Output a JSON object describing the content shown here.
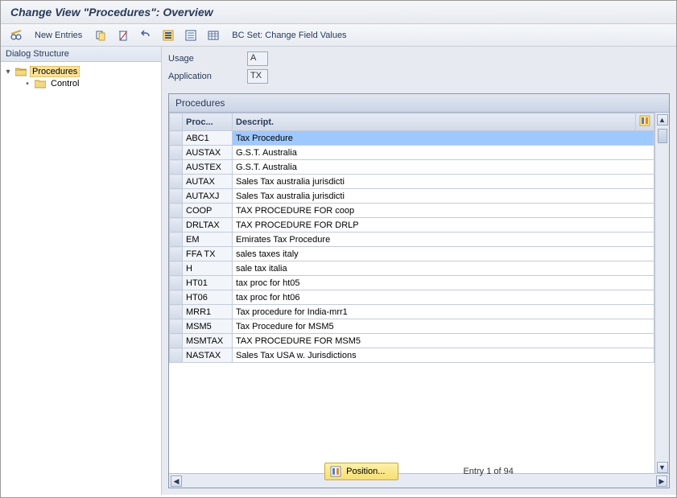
{
  "title": "Change View \"Procedures\": Overview",
  "toolbar": {
    "new_entries_label": "New Entries",
    "bcset_label": "BC Set: Change Field Values"
  },
  "sidebar": {
    "header": "Dialog Structure",
    "items": [
      {
        "label": "Procedures",
        "expanded": true,
        "selected": true,
        "folder": "open"
      },
      {
        "label": "Control",
        "expanded": false,
        "selected": false,
        "folder": "closed"
      }
    ]
  },
  "form": {
    "usage_label": "Usage",
    "usage_value": "A",
    "application_label": "Application",
    "application_value": "TX"
  },
  "table": {
    "title": "Procedures",
    "col_proc": "Proc...",
    "col_desc": "Descript.",
    "rows": [
      {
        "proc": "ABC1",
        "desc": "Tax Procedure",
        "selected": true
      },
      {
        "proc": "AUSTAX",
        "desc": "G.S.T.  Australia"
      },
      {
        "proc": "AUSTEX",
        "desc": "G.S.T.  Australia"
      },
      {
        "proc": "AUTAX",
        "desc": "Sales Tax australia jurisdicti"
      },
      {
        "proc": "AUTAXJ",
        "desc": "Sales Tax australia jurisdicti"
      },
      {
        "proc": "COOP",
        "desc": "TAX PROCEDURE FOR coop"
      },
      {
        "proc": "DRLTAX",
        "desc": "TAX PROCEDURE FOR DRLP"
      },
      {
        "proc": "EM",
        "desc": "Emirates Tax Procedure"
      },
      {
        "proc": "FFA TX",
        "desc": "sales taxes italy"
      },
      {
        "proc": "H",
        "desc": "sale tax italia"
      },
      {
        "proc": "HT01",
        "desc": "tax proc for ht05"
      },
      {
        "proc": "HT06",
        "desc": "tax proc for ht06"
      },
      {
        "proc": "MRR1",
        "desc": "Tax procedure for India-mrr1"
      },
      {
        "proc": "MSM5",
        "desc": "Tax Procedure for MSM5"
      },
      {
        "proc": "MSMTAX",
        "desc": "TAX PROCEDURE FOR MSM5"
      },
      {
        "proc": "NASTAX",
        "desc": "Sales Tax USA w. Jurisdictions"
      }
    ]
  },
  "footer": {
    "position_label": "Position...",
    "entry_text": "Entry 1 of 94"
  }
}
